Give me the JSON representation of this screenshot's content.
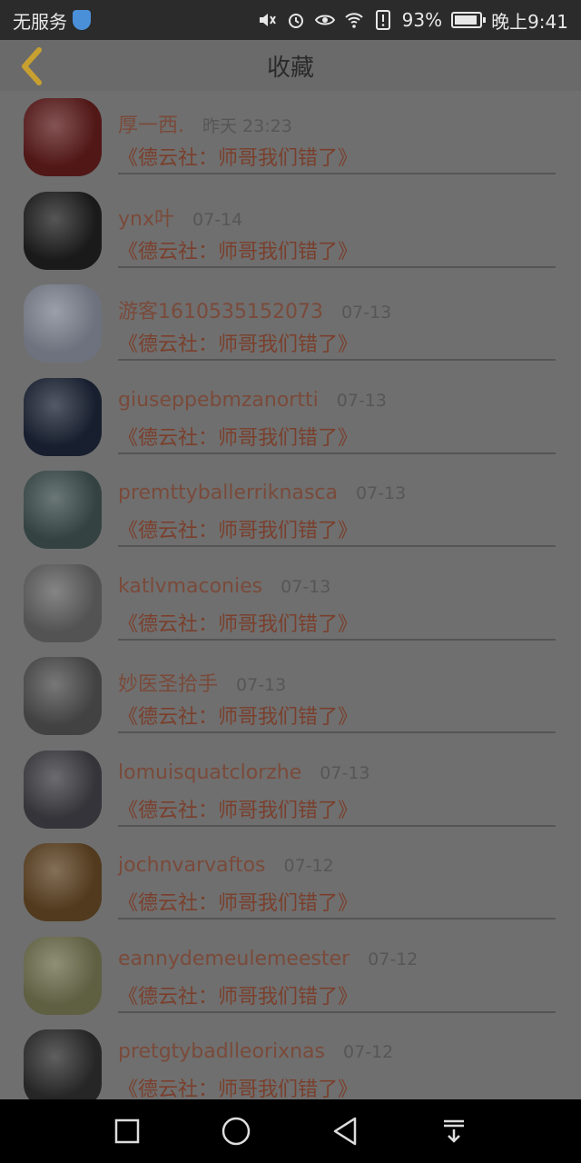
{
  "status_bar": {
    "carrier": "无服务",
    "battery_text": "93%",
    "battery_level": 0.93,
    "time": "晚上9:41"
  },
  "header": {
    "title": "收藏"
  },
  "favorites": [
    {
      "username": "厚一西.",
      "time": "昨天 23:23",
      "title": "《德云社：师哥我们错了》",
      "avatar_icon": "man-on-stage-photo",
      "avatar_color": "#5a1a1a"
    },
    {
      "username": "ynx叶",
      "time": "07-14",
      "title": "《德云社：师哥我们错了》",
      "avatar_icon": "woman-portrait-bw-photo",
      "avatar_color": "#1d1d1d"
    },
    {
      "username": "游客1610535152073",
      "time": "07-13",
      "title": "《德云社：师哥我们错了》",
      "avatar_icon": "default-user-icon",
      "avatar_color": "#7a7f8c"
    },
    {
      "username": "giuseppebmzanortti",
      "time": "07-13",
      "title": "《德云社：师哥我们错了》",
      "avatar_icon": "blue-car-photo",
      "avatar_color": "#1a2233"
    },
    {
      "username": "premttyballerriknasca",
      "time": "07-13",
      "title": "《德云社：师哥我们错了》",
      "avatar_icon": "waterfall-landscape-photo",
      "avatar_color": "#3a4a4a"
    },
    {
      "username": "katlvmaconies",
      "time": "07-13",
      "title": "《德云社：师哥我们错了》",
      "avatar_icon": "woman-portrait-photo",
      "avatar_color": "#5c5c5c"
    },
    {
      "username": "妙医圣拾手",
      "time": "07-13",
      "title": "《德云社：师哥我们错了》",
      "avatar_icon": "couple-snow-photo",
      "avatar_color": "#4a4a4a"
    },
    {
      "username": "lomuisquatclorzhe",
      "time": "07-13",
      "title": "《德云社：师哥我们错了》",
      "avatar_icon": "couple-kiss-photo",
      "avatar_color": "#3a3a40"
    },
    {
      "username": "jochnvarvaftos",
      "time": "07-12",
      "title": "《德云社：师哥我们错了》",
      "avatar_icon": "birthday-cake-photo",
      "avatar_color": "#5a4020"
    },
    {
      "username": "eannydemeulemeester",
      "time": "07-12",
      "title": "《德云社：师哥我们错了》",
      "avatar_icon": "cartoon-girl-avatar",
      "avatar_color": "#6a6a4a"
    },
    {
      "username": "pretgtybadlleorixnas",
      "time": "07-12",
      "title": "《德云社：师哥我们错了》",
      "avatar_icon": "group-bw-photo",
      "avatar_color": "#2a2a2a"
    }
  ],
  "navbar": {
    "icons": [
      "recent-apps-square-icon",
      "home-circle-icon",
      "back-triangle-icon",
      "notification-pull-down-icon"
    ]
  }
}
